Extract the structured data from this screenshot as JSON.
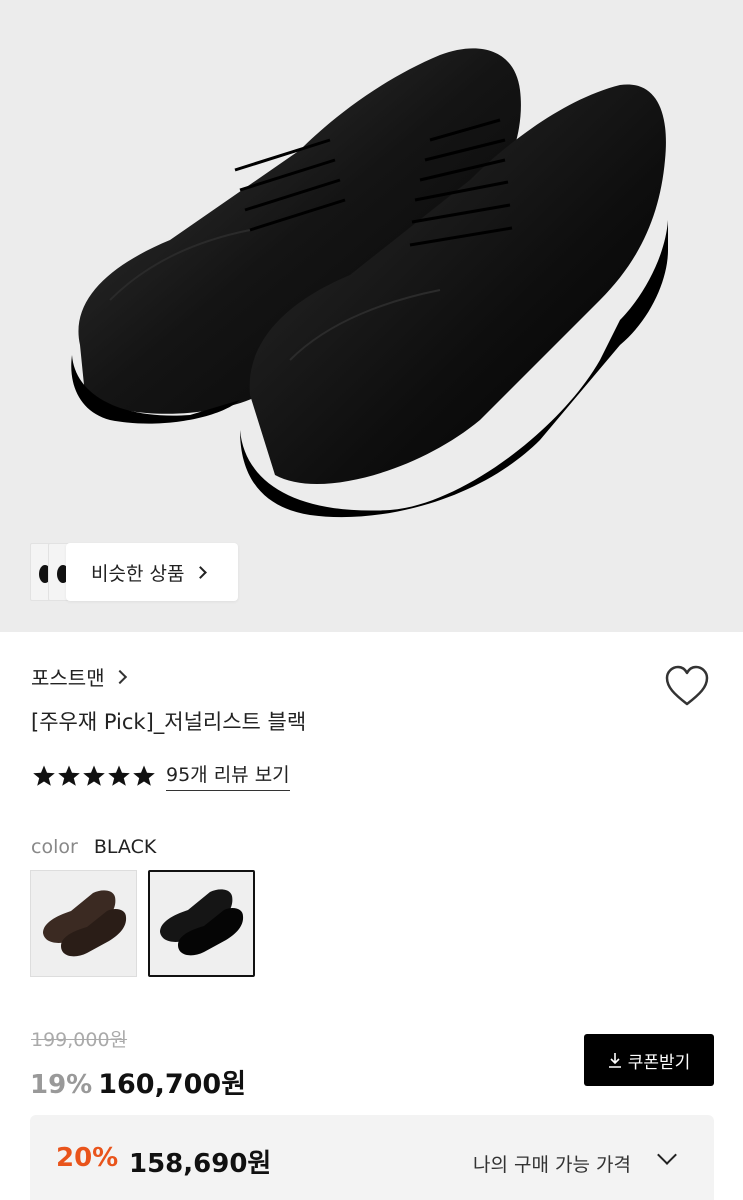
{
  "hero": {
    "image": "black-derby-shoes-pair",
    "similar_label": "비슷한 상품"
  },
  "product": {
    "brand": "포스트맨",
    "title": "[주우재 Pick]_저널리스트 블랙",
    "rating_stars": 5,
    "review_link": "95개 리뷰 보기"
  },
  "color": {
    "label": "color",
    "value": "BLACK",
    "options": [
      "brown",
      "black"
    ]
  },
  "price": {
    "original": "199,000원",
    "discount": "19%",
    "sale": "160,700원",
    "coupon_label": "쿠폰받기"
  },
  "my_price": {
    "discount": "20%",
    "price": "158,690원",
    "label": "나의 구매 가능 가격"
  },
  "colors": {
    "accent": "#e9541b",
    "button_bg": "#000000",
    "hero_bg": "#ececec"
  }
}
